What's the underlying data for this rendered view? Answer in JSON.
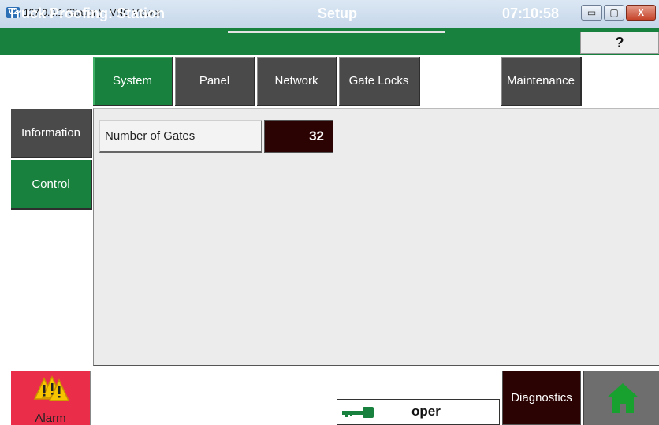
{
  "window": {
    "title": "127.0.0.1 (Station) - VNC Viewer",
    "logo_text": "V2",
    "minimize_glyph": "▭",
    "maximize_glyph": "▢",
    "close_glyph": "X"
  },
  "header": {
    "title": "Truck Proofing: Station",
    "page": "Setup",
    "time": "07:10:58",
    "help_label": "?"
  },
  "tabs": [
    {
      "label": "System",
      "active": true
    },
    {
      "label": "Panel",
      "active": false
    },
    {
      "label": "Network",
      "active": false
    },
    {
      "label": "Gate Locks",
      "active": false
    },
    {
      "label": "Maintenance",
      "active": false
    }
  ],
  "sidenav": [
    {
      "label": "Information",
      "active": false
    },
    {
      "label": "Control",
      "active": true
    }
  ],
  "content": {
    "gates_label": "Number of Gates",
    "gates_value": "32"
  },
  "footer": {
    "alarm_label": "Alarm",
    "user": "oper",
    "diagnostics_label": "Diagnostics"
  },
  "icons": {
    "alarm": "warning-triangles-icon",
    "key": "key-icon",
    "home": "home-icon"
  },
  "colors": {
    "accent_green": "#17813d",
    "dark_tab": "#4a4a4a",
    "alarm_red": "#ea2d48",
    "value_bg": "#2c0303"
  }
}
